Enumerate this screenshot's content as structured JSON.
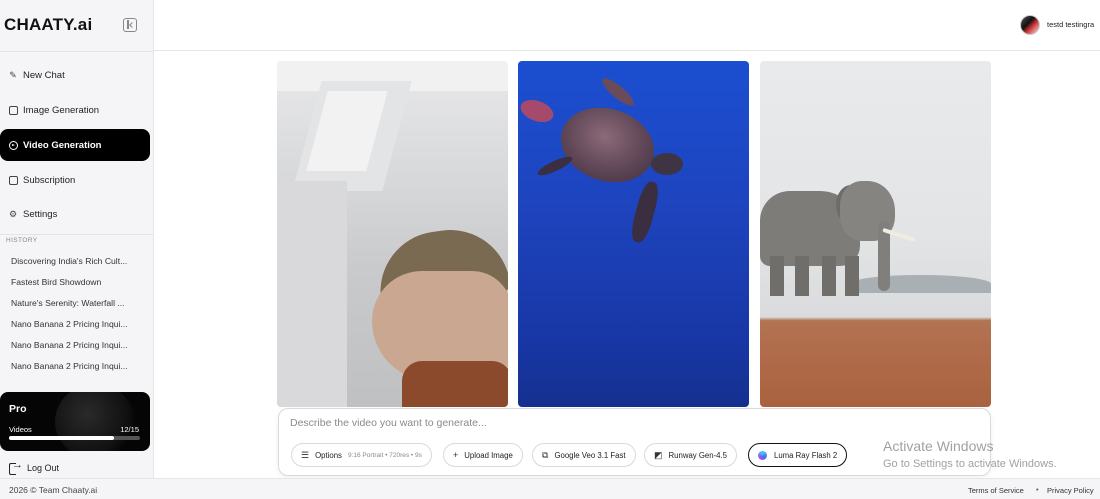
{
  "brand": "CHAATY.ai",
  "nav": [
    {
      "label": "New Chat",
      "icon": "pencil-icon"
    },
    {
      "label": "Image Generation",
      "icon": "image-icon"
    },
    {
      "label": "Video Generation",
      "icon": "video-play-icon",
      "active": true
    },
    {
      "label": "Subscription",
      "icon": "card-icon"
    },
    {
      "label": "Settings",
      "icon": "gear-icon"
    }
  ],
  "history": {
    "label": "HISTORY",
    "items": [
      "Discovering India's Rich Cult...",
      "Fastest Bird Showdown",
      "Nature's Serenity: Waterfall ...",
      "Nano Banana 2 Pricing Inqui...",
      "Nano Banana 2 Pricing Inqui...",
      "Nano Banana 2 Pricing Inqui..."
    ]
  },
  "plan": {
    "title": "Pro",
    "videos_label": "Videos",
    "count": "12/15",
    "progress": 0.8
  },
  "logout_label": "Log Out",
  "user": {
    "name": "testd testingra"
  },
  "prompt": {
    "placeholder": "Describe the video you want to generate...",
    "chips": {
      "options": {
        "label": "Options",
        "sub": "9:16 Portrait • 720res • 9s",
        "icon": "sliders-icon"
      },
      "upload": {
        "label": "Upload Image",
        "icon": "plus-icon"
      },
      "model1": {
        "label": "Google Veo 3.1 Fast",
        "icon": "google-veo-icon"
      },
      "model2": {
        "label": "Runway Gen-4.5",
        "icon": "runway-icon"
      },
      "model3": {
        "label": "Luma Ray Flash 2",
        "icon": "luma-icon",
        "selected": true
      }
    }
  },
  "watermark": {
    "title": "Activate Windows",
    "subtitle": "Go to Settings to activate Windows."
  },
  "footer": {
    "copyright": "2026 © Team Chaaty.ai",
    "terms": "Terms of Service",
    "separator": "•",
    "privacy": "Privacy Policy"
  }
}
